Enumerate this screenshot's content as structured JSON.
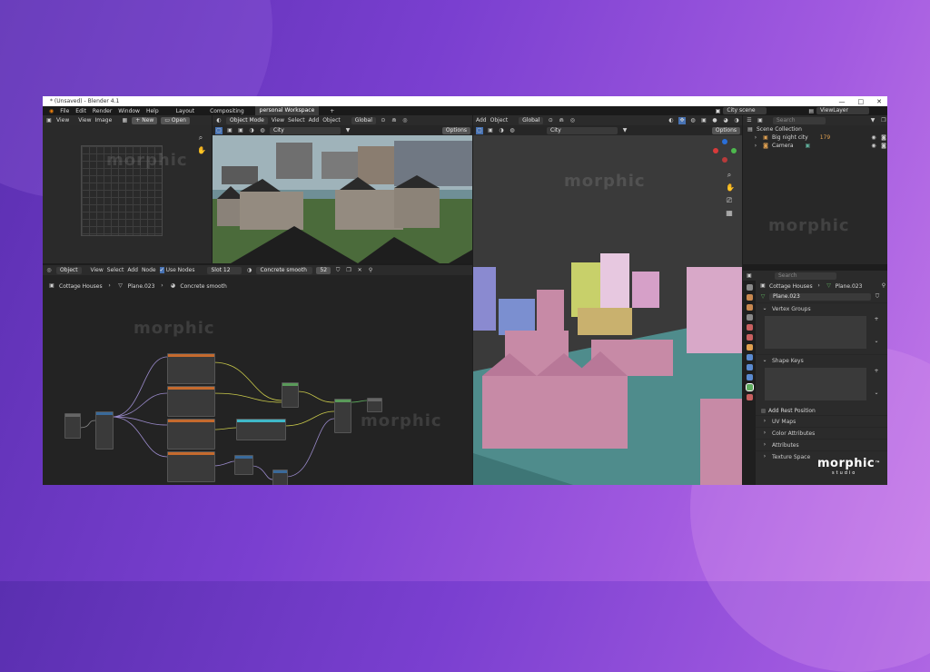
{
  "window": {
    "title": "* (Unsaved) - Blender 4.1",
    "controls": [
      "—",
      "□",
      "✕"
    ]
  },
  "menu": {
    "items": [
      "File",
      "Edit",
      "Render",
      "Window",
      "Help"
    ],
    "workspaces": [
      "Layout",
      "Compositing",
      "personal Workspace"
    ],
    "add_tab": "+",
    "scene": "City scene",
    "view_layer": "ViewLayer"
  },
  "image_editor": {
    "menu": [
      "View",
      "View",
      "Image"
    ],
    "new_label": "New",
    "open_label": "Open"
  },
  "viewport_camera": {
    "mode": "Object Mode",
    "menu": [
      "View",
      "Select",
      "Add",
      "Object"
    ],
    "orientation": "Global",
    "collection": "City",
    "options_label": "Options"
  },
  "viewport_main": {
    "menu": [
      "Add",
      "Object"
    ],
    "orientation": "Global",
    "collection": "City",
    "options_label": "Options"
  },
  "node_editor": {
    "type": "Object",
    "menu": [
      "View",
      "Select",
      "Add",
      "Node"
    ],
    "use_nodes_label": "Use Nodes",
    "slot": "Slot 12",
    "material": "Concrete smooth",
    "user_count": "52",
    "breadcrumb": [
      "Cottage Houses",
      "Plane.023",
      "Concrete smooth"
    ]
  },
  "outliner": {
    "search_placeholder": "Search",
    "root": "Scene Collection",
    "items": [
      {
        "label": "Big night city",
        "badge": "179"
      },
      {
        "label": "Camera",
        "badge": ""
      }
    ]
  },
  "properties": {
    "search_placeholder": "Search",
    "breadcrumb": [
      "Cottage Houses",
      "Plane.023"
    ],
    "mesh_name": "Plane.023",
    "sections": {
      "vertex_groups": "Vertex Groups",
      "shape_keys": "Shape Keys",
      "add_rest_position": "Add Rest Position",
      "uv_maps": "UV Maps",
      "color_attributes": "Color Attributes",
      "attributes": "Attributes",
      "texture_space": "Texture Space"
    }
  },
  "watermark": {
    "brand": "morphic",
    "sub": "studio",
    "tm": "™"
  },
  "colors": {
    "accent": "#4772b3",
    "node_orange": "#c56a2e",
    "house_pink": "#c78aa6",
    "ground_teal": "#4f8c8c"
  }
}
